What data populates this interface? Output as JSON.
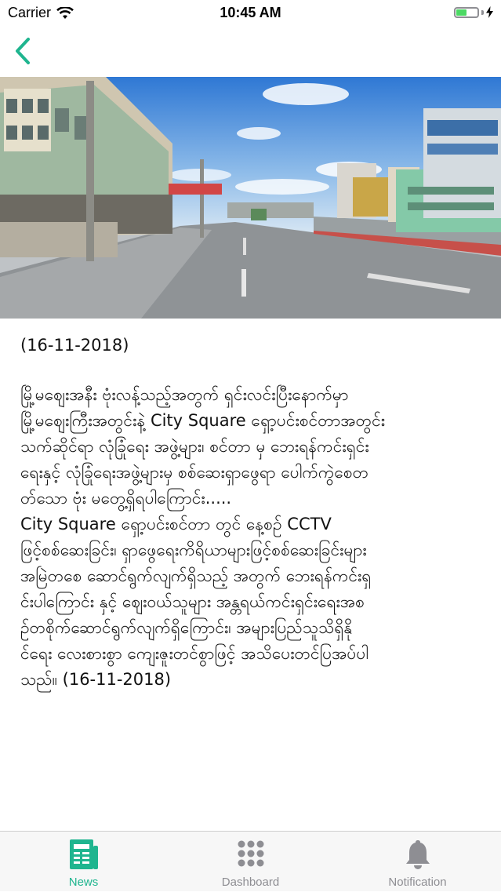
{
  "status_bar": {
    "carrier": "Carrier",
    "time": "10:45 AM",
    "battery_level": 0.5
  },
  "nav": {
    "back_icon": "chevron-left-icon"
  },
  "hero": {
    "description_icon": "street-photo"
  },
  "article": {
    "date": "(16-11-2018)",
    "body": "မြို့မဈေးအနီး ဗုံးလန့်သည့်အတွက် ရှင်းလင်းပြီးနောက်မှာ\nမြို့မဈေးကြီးအတွင်းနဲ့ City Square ရှော့ပင်းစင်တာအတွင်း\nသက်ဆိုင်ရာ လုံခြုံရေး အဖွဲ့များ၊ စင်တာ မှ ဘေးရန်ကင်းရှင်း\nရေးနှင့် လုံခြုံရေးအဖွဲ့များမှ စစ်ဆေးရှာဖွေရာ ပေါက်ကွဲစေတ\nတ်သော ဗုံး မတွေ့ရှိရပါကြောင်း.....\nCity Square ရှော့ပင်းစင်တာ တွင် နေ့စဉ် CCTV\nဖြင့်စစ်ဆေးခြင်း၊ ရှာဖွေရေးကိရိယာများဖြင့်စစ်ဆေးခြင်းများ\nအမြဲတစေ ဆောင်ရွက်လျက်ရှိသည့် အတွက် ဘေးရန်ကင်းရှ\nင်းပါကြောင်း နှင့် ဈေးဝယ်သူများ အန္တရယ်ကင်းရှင်းရေးအစ\nဉ်တစိုက်ဆောင်ရွက်လျက်ရှိကြောင်း၊ အများပြည်သူသိရှိနို\nင်ရေး လေးစားစွာ ကျေးဇူးတင်စွာဖြင့် အသိပေးတင်ပြအပ်ပါ\nသည်။ (16-11-2018)"
  },
  "tabs": [
    {
      "label": "News",
      "icon": "newspaper-icon",
      "active": true
    },
    {
      "label": "Dashboard",
      "icon": "grid-dots-icon",
      "active": false
    },
    {
      "label": "Notification",
      "icon": "bell-icon",
      "active": false
    }
  ],
  "colors": {
    "accent": "#1fb58f",
    "inactive": "#8e8e93",
    "battery": "#4cd964"
  }
}
